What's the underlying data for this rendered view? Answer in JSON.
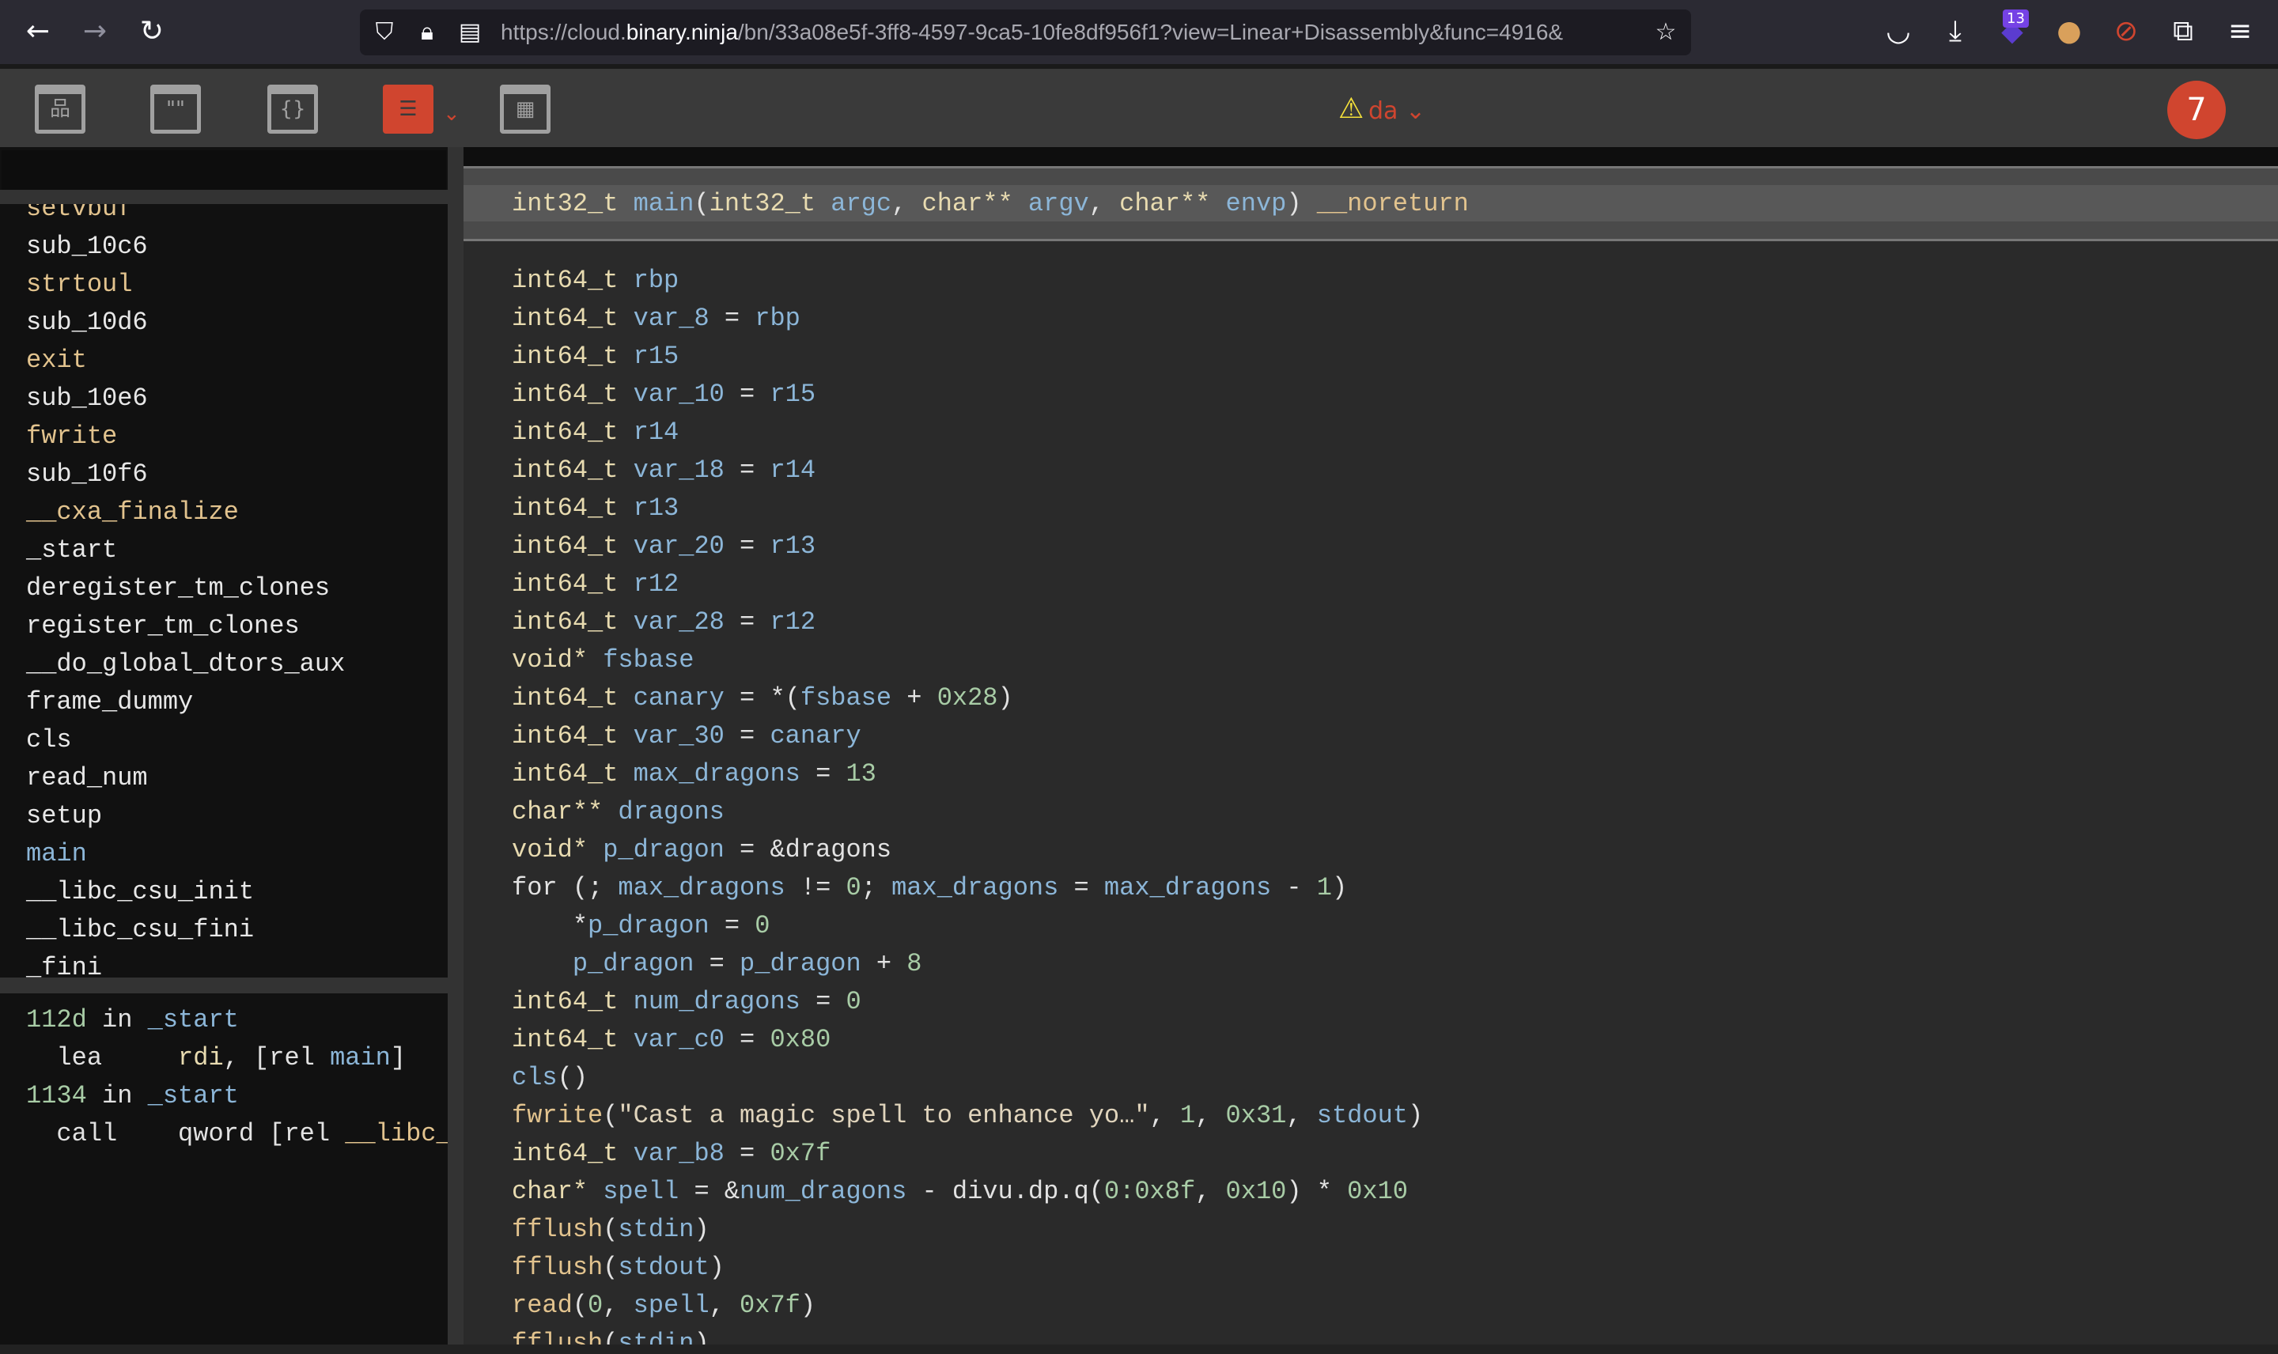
{
  "browser": {
    "url_prefix": "https://cloud.",
    "url_domain": "binary.ninja",
    "url_rest": "/bn/33a08e5f-3ff8-4597-9ca5-10fe8df956f1?view=Linear+Disassembly&func=4916&",
    "extension_badge": "13",
    "icons": [
      "back-icon",
      "forward-icon",
      "reload-icon",
      "shield-icon",
      "lock-icon",
      "permissions-icon",
      "bookmark-star-icon",
      "pocket-icon",
      "download-icon",
      "extension-icon",
      "cookie-icon",
      "blocker-icon",
      "extensions-puzzle-icon",
      "menu-icon"
    ]
  },
  "toolbar": {
    "views": [
      {
        "name": "graph-view",
        "glyph": "品",
        "active": false
      },
      {
        "name": "strings-view",
        "glyph": "\"\"",
        "active": false
      },
      {
        "name": "types-view",
        "glyph": "{}",
        "active": false
      },
      {
        "name": "linear-view",
        "glyph": "☰",
        "active": true
      },
      {
        "name": "hex-view",
        "glyph": "▦",
        "active": false
      }
    ],
    "chevron": "⌄",
    "project_warning": "⚠",
    "project_label": "da",
    "avatar_label": "7",
    "accent_color": "#d0452f"
  },
  "sidebar": {
    "functions": [
      {
        "name": "setvbuf",
        "kind": "import"
      },
      {
        "name": "sub_10c6",
        "kind": "local"
      },
      {
        "name": "strtoul",
        "kind": "import"
      },
      {
        "name": "sub_10d6",
        "kind": "local"
      },
      {
        "name": "exit",
        "kind": "import"
      },
      {
        "name": "sub_10e6",
        "kind": "local"
      },
      {
        "name": "fwrite",
        "kind": "import"
      },
      {
        "name": "sub_10f6",
        "kind": "local"
      },
      {
        "name": "__cxa_finalize",
        "kind": "import"
      },
      {
        "name": "_start",
        "kind": "local"
      },
      {
        "name": "deregister_tm_clones",
        "kind": "local"
      },
      {
        "name": "register_tm_clones",
        "kind": "local"
      },
      {
        "name": "__do_global_dtors_aux",
        "kind": "local"
      },
      {
        "name": "frame_dummy",
        "kind": "local"
      },
      {
        "name": "cls",
        "kind": "local"
      },
      {
        "name": "read_num",
        "kind": "local"
      },
      {
        "name": "setup",
        "kind": "local"
      },
      {
        "name": "main",
        "kind": "selected"
      },
      {
        "name": "__libc_csu_init",
        "kind": "local"
      },
      {
        "name": "__libc_csu_fini",
        "kind": "local"
      },
      {
        "name": "_fini",
        "kind": "local"
      }
    ],
    "xrefs": [
      [
        [
          "n",
          "112d"
        ],
        [
          "p",
          " in "
        ],
        [
          "v",
          "_start"
        ]
      ],
      [
        [
          "p",
          "  lea     "
        ],
        [
          "t",
          "rdi"
        ],
        [
          "p",
          ", [rel "
        ],
        [
          "v",
          "main"
        ],
        [
          "p",
          "]"
        ]
      ],
      [
        [
          "n",
          "1134"
        ],
        [
          "p",
          " in "
        ],
        [
          "v",
          "_start"
        ]
      ],
      [
        [
          "p",
          "  call    qword [rel "
        ],
        [
          "f",
          "__libc_"
        ]
      ]
    ]
  },
  "code": {
    "header": [
      [
        "t",
        "int32_t "
      ],
      [
        "v",
        "main"
      ],
      [
        "p",
        "("
      ],
      [
        "t",
        "int32_t "
      ],
      [
        "v",
        "argc"
      ],
      [
        "p",
        ", "
      ],
      [
        "t",
        "char** "
      ],
      [
        "v",
        "argv"
      ],
      [
        "p",
        ", "
      ],
      [
        "t",
        "char** "
      ],
      [
        "v",
        "envp"
      ],
      [
        "p",
        ") "
      ],
      [
        "f",
        "__noreturn"
      ]
    ],
    "lines": [
      [
        [
          "t",
          "int64_t "
        ],
        [
          "v",
          "rbp"
        ]
      ],
      [
        [
          "t",
          "int64_t "
        ],
        [
          "v",
          "var_8"
        ],
        [
          "p",
          " = "
        ],
        [
          "v",
          "rbp"
        ]
      ],
      [
        [
          "t",
          "int64_t "
        ],
        [
          "v",
          "r15"
        ]
      ],
      [
        [
          "t",
          "int64_t "
        ],
        [
          "v",
          "var_10"
        ],
        [
          "p",
          " = "
        ],
        [
          "v",
          "r15"
        ]
      ],
      [
        [
          "t",
          "int64_t "
        ],
        [
          "v",
          "r14"
        ]
      ],
      [
        [
          "t",
          "int64_t "
        ],
        [
          "v",
          "var_18"
        ],
        [
          "p",
          " = "
        ],
        [
          "v",
          "r14"
        ]
      ],
      [
        [
          "t",
          "int64_t "
        ],
        [
          "v",
          "r13"
        ]
      ],
      [
        [
          "t",
          "int64_t "
        ],
        [
          "v",
          "var_20"
        ],
        [
          "p",
          " = "
        ],
        [
          "v",
          "r13"
        ]
      ],
      [
        [
          "t",
          "int64_t "
        ],
        [
          "v",
          "r12"
        ]
      ],
      [
        [
          "t",
          "int64_t "
        ],
        [
          "v",
          "var_28"
        ],
        [
          "p",
          " = "
        ],
        [
          "v",
          "r12"
        ]
      ],
      [
        [
          "t",
          "void* "
        ],
        [
          "v",
          "fsbase"
        ]
      ],
      [
        [
          "t",
          "int64_t "
        ],
        [
          "v",
          "canary"
        ],
        [
          "p",
          " = *("
        ],
        [
          "v",
          "fsbase"
        ],
        [
          "p",
          " + "
        ],
        [
          "n",
          "0x28"
        ],
        [
          "p",
          ")"
        ]
      ],
      [
        [
          "t",
          "int64_t "
        ],
        [
          "v",
          "var_30"
        ],
        [
          "p",
          " = "
        ],
        [
          "v",
          "canary"
        ]
      ],
      [
        [
          "t",
          "int64_t "
        ],
        [
          "v",
          "max_dragons"
        ],
        [
          "p",
          " = "
        ],
        [
          "n",
          "13"
        ]
      ],
      [
        [
          "t",
          "char** "
        ],
        [
          "v",
          "dragons"
        ]
      ],
      [
        [
          "t",
          "void* "
        ],
        [
          "v",
          "p_dragon"
        ],
        [
          "p",
          " = &dragons"
        ]
      ],
      [
        [
          "p",
          "for (; "
        ],
        [
          "v",
          "max_dragons"
        ],
        [
          "p",
          " != "
        ],
        [
          "n",
          "0"
        ],
        [
          "p",
          "; "
        ],
        [
          "v",
          "max_dragons"
        ],
        [
          "p",
          " = "
        ],
        [
          "v",
          "max_dragons"
        ],
        [
          "p",
          " - "
        ],
        [
          "n",
          "1"
        ],
        [
          "p",
          ")"
        ]
      ],
      [
        [
          "p",
          "    *"
        ],
        [
          "v",
          "p_dragon"
        ],
        [
          "p",
          " = "
        ],
        [
          "n",
          "0"
        ]
      ],
      [
        [
          "p",
          "    "
        ],
        [
          "v",
          "p_dragon"
        ],
        [
          "p",
          " = "
        ],
        [
          "v",
          "p_dragon"
        ],
        [
          "p",
          " + "
        ],
        [
          "n",
          "8"
        ]
      ],
      [
        [
          "t",
          "int64_t "
        ],
        [
          "v",
          "num_dragons"
        ],
        [
          "p",
          " = "
        ],
        [
          "n",
          "0"
        ]
      ],
      [
        [
          "t",
          "int64_t "
        ],
        [
          "v",
          "var_c0"
        ],
        [
          "p",
          " = "
        ],
        [
          "n",
          "0x80"
        ]
      ],
      [
        [
          "v",
          "cls"
        ],
        [
          "p",
          "()"
        ]
      ],
      [
        [
          "f",
          "fwrite"
        ],
        [
          "p",
          "("
        ],
        [
          "s",
          "\"Cast a magic spell to enhance yo…\""
        ],
        [
          "p",
          ", "
        ],
        [
          "n",
          "1"
        ],
        [
          "p",
          ", "
        ],
        [
          "n",
          "0x31"
        ],
        [
          "p",
          ", "
        ],
        [
          "v",
          "stdout"
        ],
        [
          "p",
          ")"
        ]
      ],
      [
        [
          "t",
          "int64_t "
        ],
        [
          "v",
          "var_b8"
        ],
        [
          "p",
          " = "
        ],
        [
          "n",
          "0x7f"
        ]
      ],
      [
        [
          "t",
          "char* "
        ],
        [
          "v",
          "spell"
        ],
        [
          "p",
          " = &"
        ],
        [
          "v",
          "num_dragons"
        ],
        [
          "p",
          " - divu.dp.q("
        ],
        [
          "n",
          "0:0x8f"
        ],
        [
          "p",
          ", "
        ],
        [
          "n",
          "0x10"
        ],
        [
          "p",
          ") * "
        ],
        [
          "n",
          "0x10"
        ]
      ],
      [
        [
          "f",
          "fflush"
        ],
        [
          "p",
          "("
        ],
        [
          "v",
          "stdin"
        ],
        [
          "p",
          ")"
        ]
      ],
      [
        [
          "f",
          "fflush"
        ],
        [
          "p",
          "("
        ],
        [
          "v",
          "stdout"
        ],
        [
          "p",
          ")"
        ]
      ],
      [
        [
          "f",
          "read"
        ],
        [
          "p",
          "("
        ],
        [
          "n",
          "0"
        ],
        [
          "p",
          ", "
        ],
        [
          "v",
          "spell"
        ],
        [
          "p",
          ", "
        ],
        [
          "n",
          "0x7f"
        ],
        [
          "p",
          ")"
        ]
      ],
      [
        [
          "f",
          "fflush"
        ],
        [
          "p",
          "("
        ],
        [
          "v",
          "stdin"
        ],
        [
          "p",
          ")"
        ]
      ]
    ]
  }
}
